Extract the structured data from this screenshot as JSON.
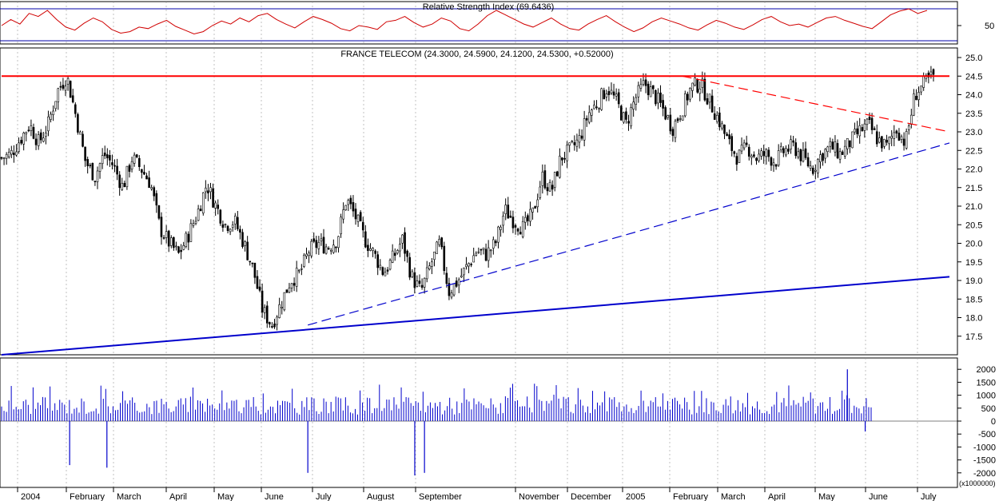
{
  "rsi_panel": {
    "title": "Relative Strength Index (69.6436)",
    "tick_labels": [
      "50"
    ],
    "series": [
      50,
      58,
      52,
      66,
      62,
      70,
      58,
      48,
      44,
      53,
      60,
      55,
      45,
      40,
      42,
      48,
      46,
      52,
      57,
      49,
      44,
      39,
      42,
      50,
      56,
      52,
      60,
      55,
      63,
      66,
      58,
      52,
      47,
      55,
      62,
      58,
      53,
      46,
      43,
      50,
      48,
      45,
      55,
      57,
      62,
      54,
      48,
      52,
      60,
      56,
      46,
      43,
      52,
      63,
      70,
      64,
      58,
      52,
      48,
      54,
      60,
      52,
      46,
      44,
      52,
      58,
      63,
      55,
      48,
      42,
      47,
      55,
      60,
      56,
      52,
      47,
      44,
      51,
      57,
      53,
      48,
      45,
      51,
      58,
      62,
      55,
      50,
      52,
      48,
      54,
      60,
      62,
      57,
      53,
      49,
      46,
      55,
      64,
      69,
      72,
      66,
      70
    ]
  },
  "price_panel": {
    "title": "FRANCE TELECOM (24.3000, 24.5900, 24.1200, 24.5300, +0.52000)",
    "y_tick_labels": [
      "25.0",
      "24.5",
      "24.0",
      "23.5",
      "23.0",
      "22.5",
      "22.0",
      "21.5",
      "21.0",
      "20.5",
      "20.0",
      "19.5",
      "19.0",
      "18.5",
      "18.0",
      "17.5"
    ],
    "resistance_level": 24.5
  },
  "volume_panel": {
    "y_tick_labels": [
      "2000",
      "1500",
      "1000",
      "500",
      "0",
      "-500",
      "-1000",
      "-1500",
      "-2000"
    ],
    "unit_label": "(x1000000)"
  },
  "x_axis": {
    "month_labels": [
      "2004",
      "February",
      "March",
      "April",
      "May",
      "June",
      "July",
      "August",
      "September",
      "November",
      "December",
      "2005",
      "February",
      "March",
      "April",
      "May",
      "June",
      "July"
    ]
  },
  "chart_data": {
    "type": "candlestick",
    "title": "FRANCE TELECOM (24.3000, 24.5900, 24.1200, 24.5300, +0.52000)",
    "ylim": [
      17.0,
      25.2
    ],
    "last": {
      "open": 24.3,
      "high": 24.59,
      "low": 24.12,
      "close": 24.53,
      "change": 0.52
    },
    "close_path": [
      22.3,
      22.4,
      22.8,
      23.2,
      22.7,
      23.2,
      24.1,
      24.5,
      23.4,
      22.2,
      21.8,
      22.4,
      22.1,
      21.5,
      22.3,
      22.0,
      21.6,
      20.4,
      20.0,
      19.7,
      20.2,
      20.8,
      21.6,
      21.0,
      20.5,
      20.6,
      20.0,
      19.3,
      18.2,
      17.8,
      18.4,
      19.0,
      19.2,
      19.8,
      20.0,
      19.9,
      20.1,
      21.2,
      20.7,
      20.1,
      19.7,
      19.2,
      19.6,
      20.1,
      19.1,
      18.7,
      19.4,
      20.0,
      18.7,
      19.0,
      19.4,
      19.8,
      19.7,
      20.0,
      20.9,
      20.6,
      20.4,
      20.8,
      21.8,
      21.4,
      22.3,
      22.5,
      22.8,
      23.5,
      23.8,
      24.2,
      23.8,
      23.2,
      23.9,
      24.3,
      24.0,
      23.6,
      23.1,
      23.6,
      24.2,
      24.3,
      23.8,
      23.3,
      22.7,
      22.3,
      22.6,
      22.3,
      22.4,
      22.2,
      22.5,
      22.6,
      22.3,
      22.0,
      22.4,
      22.6,
      22.4,
      22.7,
      23.0,
      23.2,
      22.8,
      22.6,
      23.1,
      22.7,
      24.0,
      24.3,
      24.5
    ],
    "trendlines": [
      {
        "color": "#ff0000",
        "style": "solid",
        "start": [
          "2003-12-22",
          24.5
        ],
        "end": [
          "2005-07-29",
          24.5
        ]
      },
      {
        "color": "#0000cc",
        "style": "solid",
        "start": [
          "2003-12-22",
          17.0
        ],
        "end": [
          "2005-07-29",
          19.1
        ]
      },
      {
        "color": "#0000cc",
        "style": "dashed",
        "start": [
          "2004-06-28",
          17.8
        ],
        "end": [
          "2005-07-29",
          22.7
        ]
      },
      {
        "color": "#ff0000",
        "style": "dashed",
        "start": [
          "2005-02-14",
          24.5
        ],
        "end": [
          "2005-07-29",
          23.0
        ]
      }
    ],
    "volume": {
      "ylim": [
        -2100,
        2100
      ],
      "spikes": [
        [
          "2004-02-02",
          -1700
        ],
        [
          "2004-02-25",
          -1800
        ],
        [
          "2004-06-28",
          -2000
        ],
        [
          "2004-09-02",
          -2100
        ],
        [
          "2004-09-08",
          -2000
        ],
        [
          "2005-06-07",
          -400
        ],
        [
          "2005-05-27",
          2000
        ]
      ]
    }
  }
}
